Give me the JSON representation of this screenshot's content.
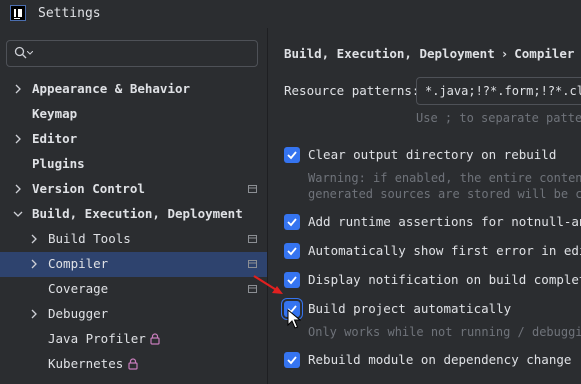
{
  "window": {
    "title": "Settings"
  },
  "search": {
    "placeholder": ""
  },
  "sidebar": {
    "items": [
      {
        "label": "Appearance & Behavior",
        "bold": true
      },
      {
        "label": "Keymap",
        "bold": true
      },
      {
        "label": "Editor",
        "bold": true
      },
      {
        "label": "Plugins",
        "bold": true
      },
      {
        "label": "Version Control",
        "bold": true
      },
      {
        "label": "Build, Execution, Deployment",
        "bold": true
      },
      {
        "label": "Build Tools",
        "bold": false
      },
      {
        "label": "Compiler",
        "bold": false,
        "selected": true
      },
      {
        "label": "Coverage",
        "bold": false
      },
      {
        "label": "Debugger",
        "bold": false
      },
      {
        "label": "Java Profiler",
        "bold": false
      },
      {
        "label": "Kubernetes",
        "bold": false
      }
    ]
  },
  "main": {
    "breadcrumb": [
      "Build, Execution, Deployment",
      "Compiler"
    ],
    "breadcrumb_sep": "›",
    "resource_patterns": {
      "label": "Resource patterns:",
      "value": "*.java;!?*.form;!?*.class;",
      "hint": "Use ; to separate patter"
    },
    "options": [
      {
        "label": "Clear output directory on rebuild",
        "checked": true
      },
      {
        "label": "Add runtime assertions for notnull-anno",
        "checked": true
      },
      {
        "label": "Automatically show first error in edito",
        "checked": true
      },
      {
        "label": "Display notification on build completio",
        "checked": true
      },
      {
        "label": "Build project automatically",
        "checked": true
      },
      {
        "label": "Rebuild module on dependency change",
        "checked": true
      }
    ],
    "notes": {
      "clear_output_1": "Warning: if enabled, the entire content",
      "clear_output_2": "generated sources are stored will be cl",
      "build_auto": "Only works while not running / debugging"
    }
  },
  "colors": {
    "background": "#2b2d30",
    "selection": "#2e436e",
    "checkbox": "#3574f0",
    "text": "#dfe1e5",
    "muted": "#6f737a",
    "annotation_arrow": "#e02020"
  }
}
